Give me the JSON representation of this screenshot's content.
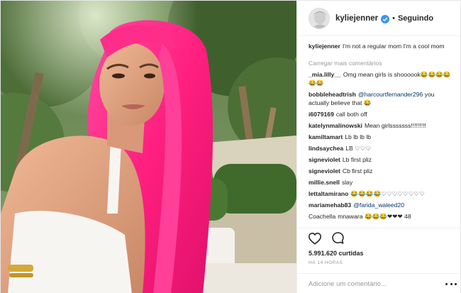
{
  "post": {
    "username": "kyliejenner",
    "follow_status": "Seguindo",
    "separator": "•",
    "caption": "I'm not a regular mom I'm a cool mom",
    "load_more_comments": "Carregar mais comentários",
    "comments": [
      {
        "user": "_mia.lilly__",
        "text": "Omg mean girls is shoooook😂😂😂😂😂😂"
      },
      {
        "user": "bobbleheadtrish",
        "mention": "@harcourtfernander296",
        "text": "you actually believe that 😂"
      },
      {
        "user": "i6079169",
        "text": "call both off"
      },
      {
        "user": "katelynmalinowski",
        "text": "Mean girlsssssss!!!!!!!!!"
      },
      {
        "user": "kamiltamart",
        "text": "Lb lb lb lb"
      },
      {
        "user": "lindsaychea",
        "text": "LB ♡♡♡"
      },
      {
        "user": "signeviolet",
        "text": "Lb first pliz"
      },
      {
        "user": "signeviolet",
        "text": "Cb first pliz"
      },
      {
        "user": "millie.snell",
        "text": "slay"
      },
      {
        "user": "lettaltamirano",
        "text": "😂😂😂😂♡♡♡♡♡♡♡♡"
      },
      {
        "user": "mariamehab83",
        "mention": "@farida_waleed20",
        "text": ""
      },
      {
        "user": "Coachella",
        "text": "mnawara 😂😂😂❤❤❤ 48"
      }
    ],
    "likes": "5.991.620 curtidas",
    "timestamp": "HÁ 14 HORAS",
    "comment_placeholder": "Adicione um comentário..."
  },
  "icons": {
    "verified": "verified-badge-icon",
    "like": "heart-icon",
    "comment": "comment-bubble-icon",
    "more": "more-options-icon"
  },
  "colors": {
    "verified_blue": "#3897f0",
    "mention": "#003569",
    "muted": "#999999",
    "hair_pink": "#ff2d8a"
  }
}
